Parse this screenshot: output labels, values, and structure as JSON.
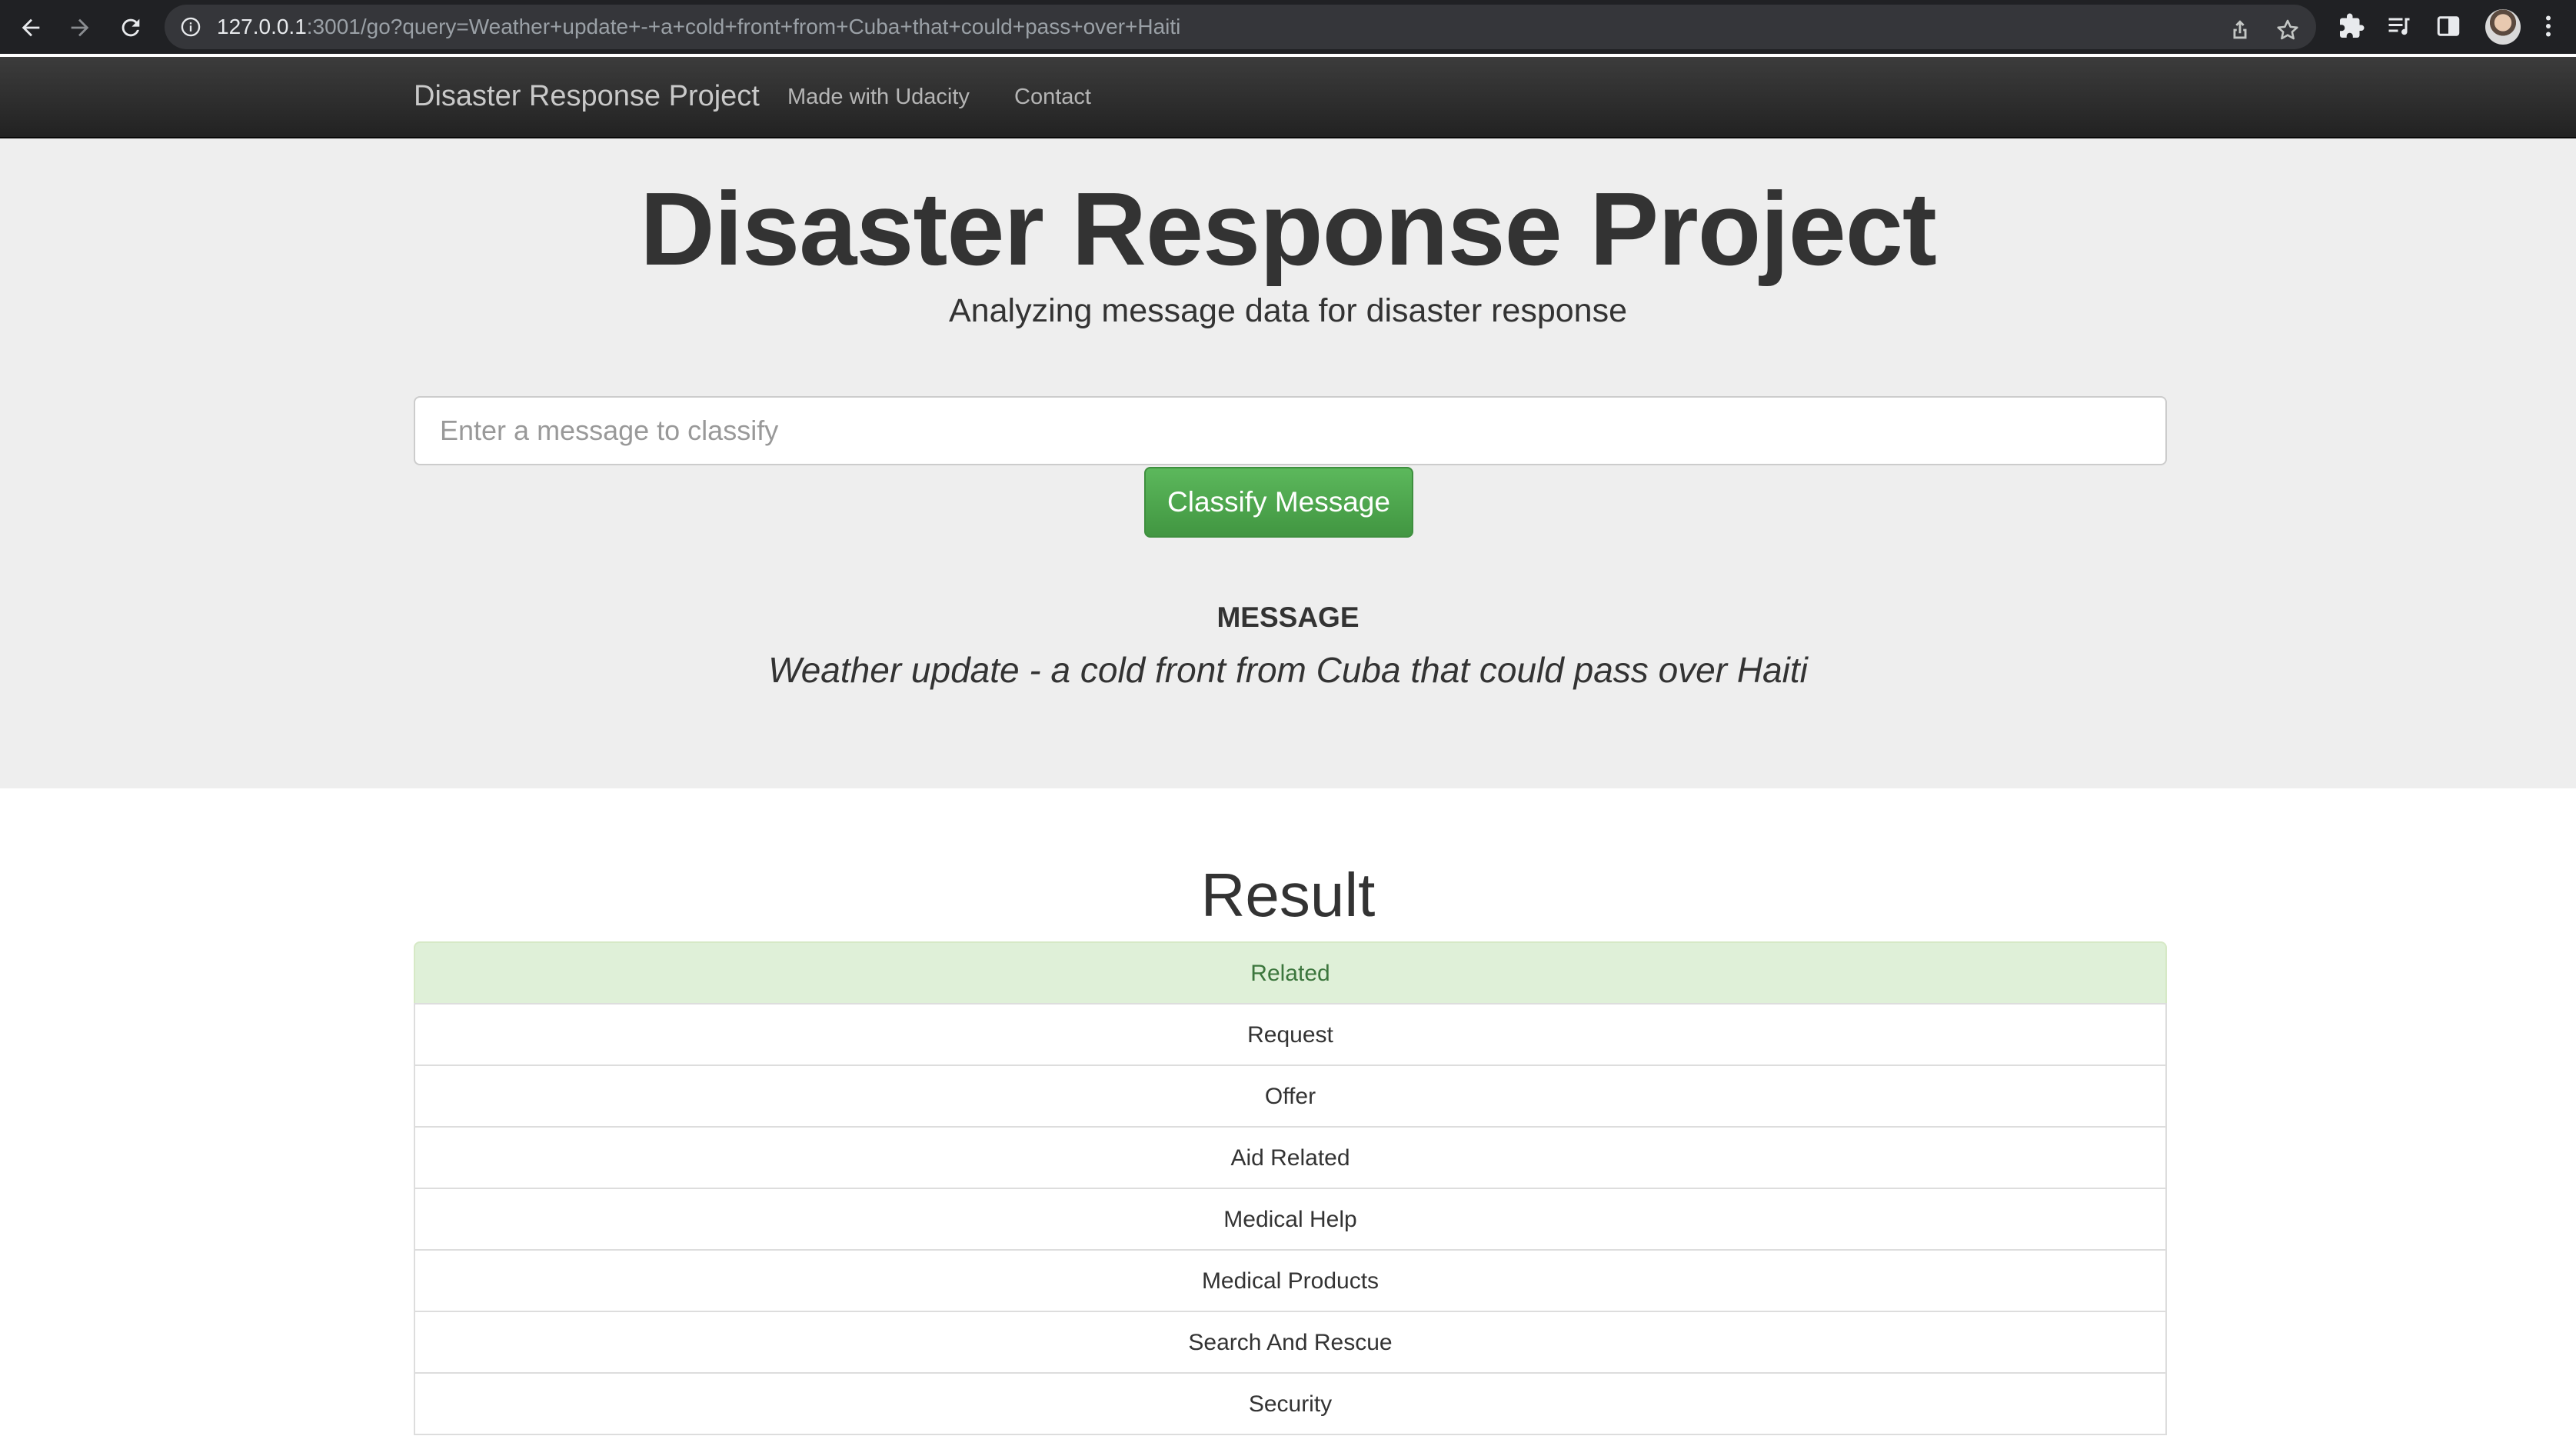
{
  "browser": {
    "url_host": "127.0.0.1",
    "url_rest": ":3001/go?query=Weather+update+-+a+cold+front+from+Cuba+that+could+pass+over+Haiti",
    "icons": [
      "back-icon",
      "forward-icon",
      "reload-icon",
      "info-icon",
      "share-icon",
      "star-icon",
      "puzzle-icon",
      "media-icon",
      "side-panel-icon",
      "more-icon"
    ]
  },
  "navbar": {
    "brand": "Disaster Response Project",
    "links": [
      "Made with Udacity",
      "Contact"
    ]
  },
  "jumbotron": {
    "title": "Disaster Response Project",
    "subtitle": "Analyzing message data for disaster response",
    "input_placeholder": "Enter a message to classify",
    "input_value": "",
    "button_label": "Classify Message",
    "message_heading": "MESSAGE",
    "message_text": "Weather update - a cold front from Cuba that could pass over Haiti"
  },
  "result": {
    "title": "Result",
    "items": [
      {
        "label": "Related",
        "positive": true
      },
      {
        "label": "Request",
        "positive": false
      },
      {
        "label": "Offer",
        "positive": false
      },
      {
        "label": "Aid Related",
        "positive": false
      },
      {
        "label": "Medical Help",
        "positive": false
      },
      {
        "label": "Medical Products",
        "positive": false
      },
      {
        "label": "Search And Rescue",
        "positive": false
      },
      {
        "label": "Security",
        "positive": false
      }
    ]
  },
  "colors": {
    "positive_bg": "#dff0d8",
    "positive_text": "#3c763d",
    "button_green": "#5cb85c",
    "jumbotron_bg": "#eeeeee",
    "navbar_bg": "#222222"
  }
}
